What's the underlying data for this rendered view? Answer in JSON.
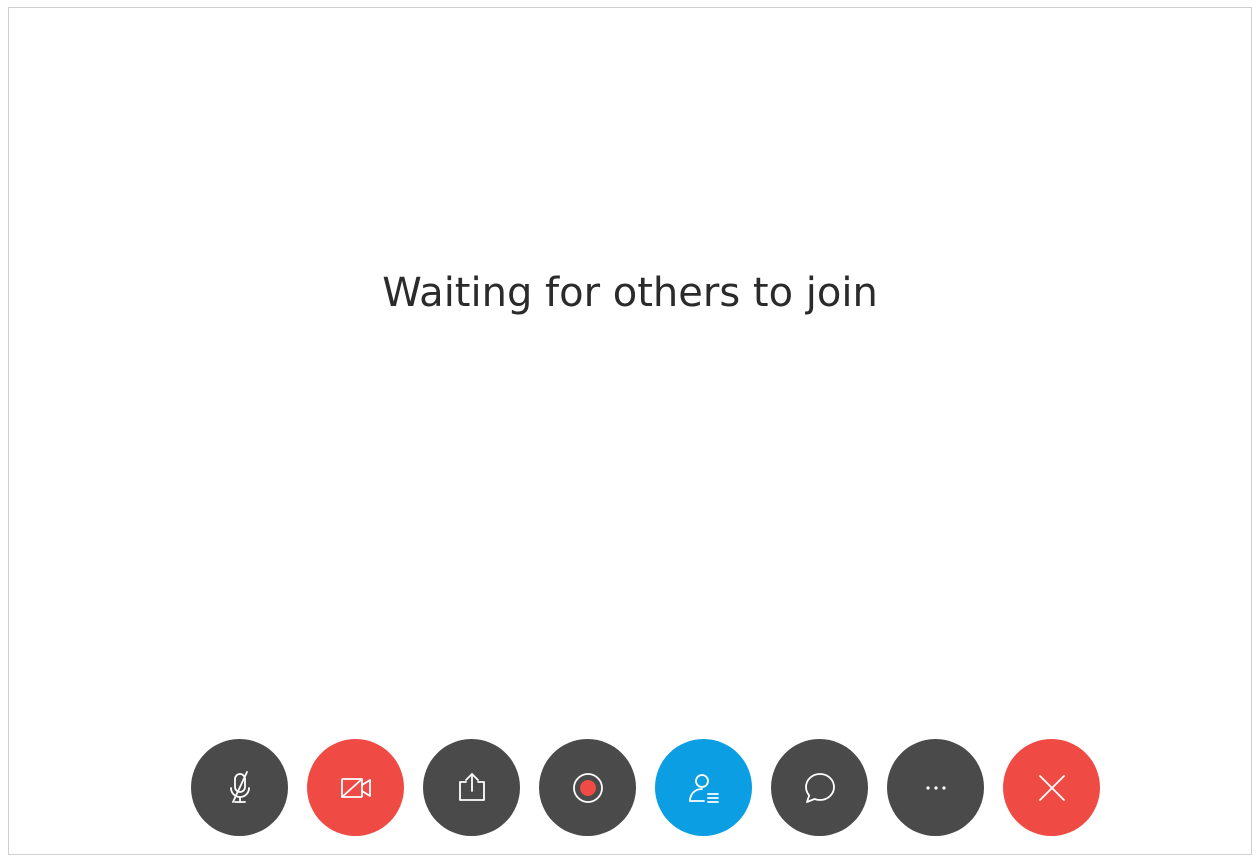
{
  "main": {
    "status_text": "Waiting for others to join"
  },
  "controls": [
    {
      "id": "mute",
      "icon": "microphone-muted-icon",
      "color": "#4a4a4a"
    },
    {
      "id": "video",
      "icon": "video-off-icon",
      "color": "#ef4b44"
    },
    {
      "id": "share",
      "icon": "share-upload-icon",
      "color": "#4a4a4a"
    },
    {
      "id": "record",
      "icon": "record-icon",
      "color": "#4a4a4a",
      "accent": "#ef4b44"
    },
    {
      "id": "participants",
      "icon": "participants-icon",
      "color": "#0b9ee3"
    },
    {
      "id": "chat",
      "icon": "chat-bubble-icon",
      "color": "#4a4a4a"
    },
    {
      "id": "more",
      "icon": "more-options-icon",
      "color": "#4a4a4a"
    },
    {
      "id": "leave",
      "icon": "close-icon",
      "color": "#ef4b44"
    }
  ]
}
